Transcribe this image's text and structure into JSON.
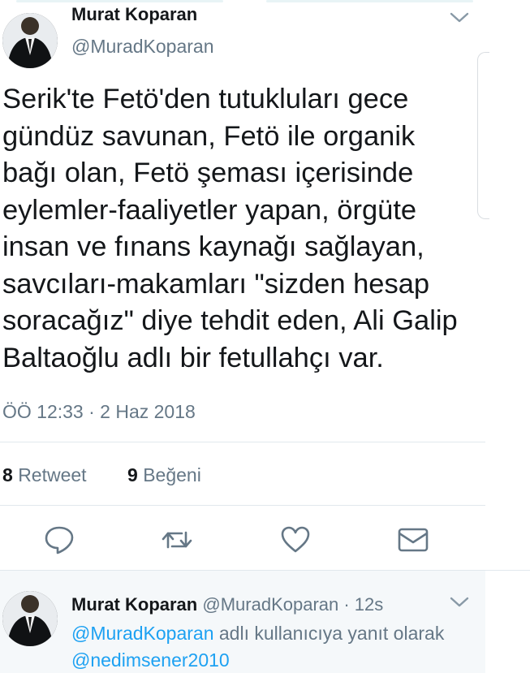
{
  "tweet": {
    "author_name": "Murat Koparan",
    "author_handle": "@MuradKoparan",
    "text": "Serik'te Fetö'den tutukluları gece\ngündüz savunan, Fetö ile organik\nbağı olan, Fetö şeması içerisinde\neylemler-faaliyetler yapan, örgüte\ninsan ve fınans kaynağı sağlayan,\nsavcıları-makamları \"sizden hesap\nsoracağız\" diye tehdit eden, Ali Galip\nBaltaoğlu adlı bir fetullahçı var.",
    "timestamp": "ÖÖ 12:33 · 2 Haz 2018",
    "retweet_count": "8",
    "retweet_label": "Retweet",
    "like_count": "9",
    "like_label": "Beğeni"
  },
  "actions": {
    "reply_icon": "reply-icon",
    "retweet_icon": "retweet-icon",
    "like_icon": "heart-icon",
    "message_icon": "envelope-icon"
  },
  "reply": {
    "author_name": "Murat Koparan",
    "handle_time": "@MuradKoparan · 12s",
    "context_mention": "@MuradKoparan",
    "context_text": " adlı kullanıcıya yanıt olarak",
    "second_mention": "@nedimsener2010"
  },
  "colors": {
    "accent": "#1da1f2",
    "muted": "#657786",
    "reply_bg": "#f5f8fa",
    "divider": "#e1e8ed"
  }
}
